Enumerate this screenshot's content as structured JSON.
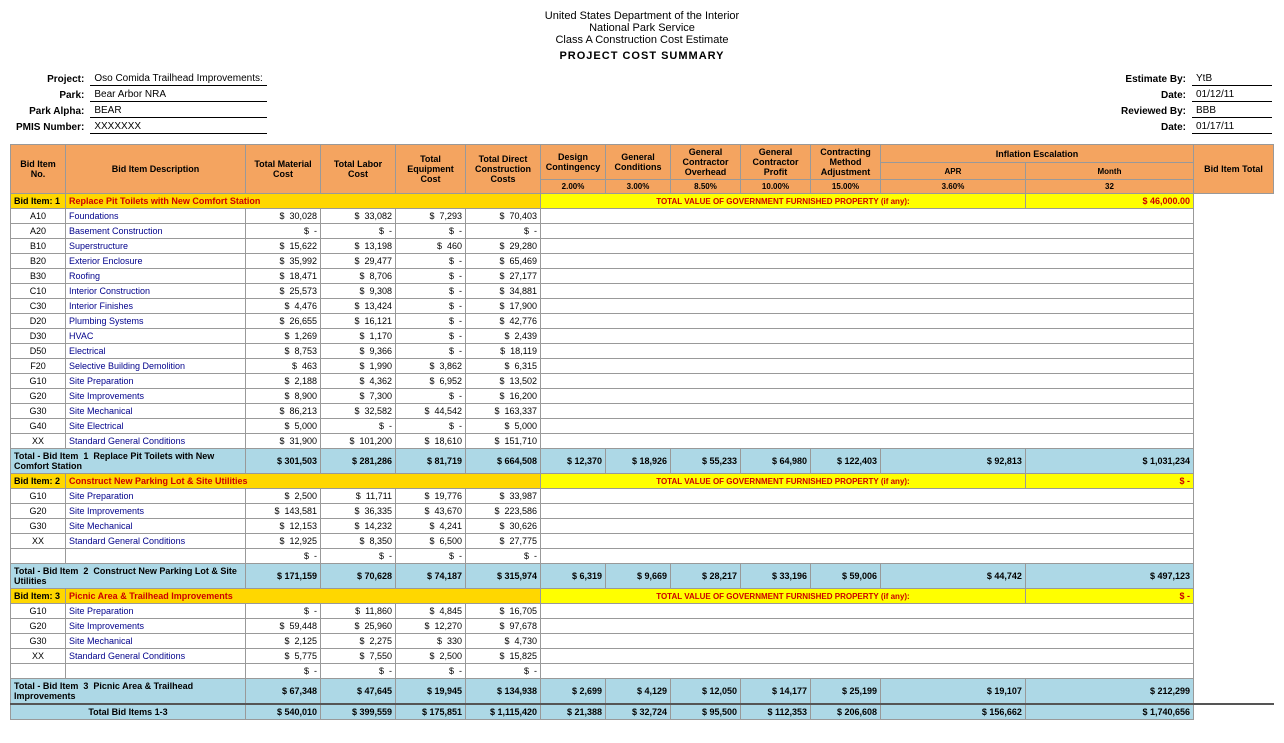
{
  "header": {
    "line1": "United States Department of the Interior",
    "line2": "National Park Service",
    "line3": "Class A Construction Cost Estimate",
    "title": "PROJECT COST SUMMARY"
  },
  "meta": {
    "project_label": "Project:",
    "project_value": "Oso Comida Trailhead Improvements:",
    "park_label": "Park:",
    "park_value": "Bear Arbor NRA",
    "alpha_label": "Park Alpha:",
    "alpha_value": "BEAR",
    "pmis_label": "PMIS Number:",
    "pmis_value": "XXXXXXX",
    "estimate_by_label": "Estimate By:",
    "estimate_by_value": "YtB",
    "date1_label": "Date:",
    "date1_value": "01/12/11",
    "reviewed_by_label": "Reviewed By:",
    "reviewed_by_value": "BBB",
    "date2_label": "Date:",
    "date2_value": "01/17/11"
  },
  "table": {
    "headers": {
      "col1": "Bid Item No.",
      "col2": "Bid Item Description",
      "col3": "Total Material Cost",
      "col4": "Total Labor Cost",
      "col5": "Total Equipment Cost",
      "col6": "Total Direct Construction Costs",
      "col7": "Design Contingency",
      "col8": "General Conditions",
      "col9": "General Contractor Overhead",
      "col10": "General Contractor Profit",
      "col11": "Contracting Method Adjustment",
      "col12_apr": "APR",
      "col12_month": "Month",
      "col12_pct": "3.60%",
      "col12_months": "32",
      "col12": "Inflation Escalation",
      "col13": "Bid Item Total",
      "pct7": "2.00%",
      "pct8": "3.00%",
      "pct9": "8.50%",
      "pct10": "10.00%",
      "pct11": "15.00%"
    },
    "bid_item_1": {
      "label": "Bid Item:",
      "number": "1",
      "desc": "Replace Pit Toilets with New Comfort Station",
      "gov_text": "TOTAL VALUE OF GOVERNMENT FURNISHED PROPERTY (if any):",
      "gov_value": "$ 46,000.00",
      "rows": [
        {
          "code": "A10",
          "desc": "Foundations",
          "mat": "$ 30,028",
          "lab": "$ 33,082",
          "eq": "$ 7,293",
          "dc": "$ 70,403"
        },
        {
          "code": "A20",
          "desc": "Basement Construction",
          "mat": "$  -",
          "lab": "$  -",
          "eq": "$  -",
          "dc": "$  -"
        },
        {
          "code": "B10",
          "desc": "Superstructure",
          "mat": "$ 15,622",
          "lab": "$ 13,198",
          "eq": "$ 460",
          "dc": "$ 29,280"
        },
        {
          "code": "B20",
          "desc": "Exterior Enclosure",
          "mat": "$ 35,992",
          "lab": "$ 29,477",
          "eq": "$  -",
          "dc": "$ 65,469"
        },
        {
          "code": "B30",
          "desc": "Roofing",
          "mat": "$ 18,471",
          "lab": "$ 8,706",
          "eq": "$  -",
          "dc": "$ 27,177"
        },
        {
          "code": "C10",
          "desc": "Interior Construction",
          "mat": "$ 25,573",
          "lab": "$ 9,308",
          "eq": "$  -",
          "dc": "$ 34,881"
        },
        {
          "code": "C30",
          "desc": "Interior Finishes",
          "mat": "$ 4,476",
          "lab": "$ 13,424",
          "eq": "$  -",
          "dc": "$ 17,900"
        },
        {
          "code": "D20",
          "desc": "Plumbing Systems",
          "mat": "$ 26,655",
          "lab": "$ 16,121",
          "eq": "$  -",
          "dc": "$ 42,776"
        },
        {
          "code": "D30",
          "desc": "HVAC",
          "mat": "$ 1,269",
          "lab": "$ 1,170",
          "eq": "$  -",
          "dc": "$ 2,439"
        },
        {
          "code": "D50",
          "desc": "Electrical",
          "mat": "$ 8,753",
          "lab": "$ 9,366",
          "eq": "$  -",
          "dc": "$ 18,119"
        },
        {
          "code": "F20",
          "desc": "Selective Building Demolition",
          "mat": "$ 463",
          "lab": "$ 1,990",
          "eq": "$ 3,862",
          "dc": "$ 6,315"
        },
        {
          "code": "G10",
          "desc": "Site Preparation",
          "mat": "$ 2,188",
          "lab": "$ 4,362",
          "eq": "$ 6,952",
          "dc": "$ 13,502"
        },
        {
          "code": "G20",
          "desc": "Site Improvements",
          "mat": "$ 8,900",
          "lab": "$ 7,300",
          "eq": "$  -",
          "dc": "$ 16,200"
        },
        {
          "code": "G30",
          "desc": "Site Mechanical",
          "mat": "$ 86,213",
          "lab": "$ 32,582",
          "eq": "$ 44,542",
          "dc": "$ 163,337"
        },
        {
          "code": "G40",
          "desc": "Site Electrical",
          "mat": "$ 5,000",
          "lab": "$  -",
          "eq": "$  -",
          "dc": "$ 5,000"
        },
        {
          "code": "XX",
          "desc": "Standard General Conditions",
          "mat": "$ 31,900",
          "lab": "$ 101,200",
          "eq": "$ 18,610",
          "dc": "$ 151,710"
        }
      ],
      "total": {
        "label": "Total - Bid Item",
        "number": "1",
        "desc": "Replace Pit Toilets with New Comfort Station",
        "mat": "$ 301,503",
        "lab": "$ 281,286",
        "eq": "$ 81,719",
        "dc": "$ 664,508",
        "des": "$ 12,370",
        "gen": "$ 18,926",
        "ovh": "$ 55,233",
        "prf": "$ 64,980",
        "cma": "$ 122,403",
        "inf": "$ 92,813",
        "tot": "$ 1,031,234"
      }
    },
    "bid_item_2": {
      "label": "Bid Item:",
      "number": "2",
      "desc": "Construct New Parking Lot & Site Utilities",
      "gov_text": "TOTAL VALUE OF GOVERNMENT FURNISHED PROPERTY (if any):",
      "gov_value": "$ -",
      "rows": [
        {
          "code": "G10",
          "desc": "Site Preparation",
          "mat": "$ 2,500",
          "lab": "$ 11,711",
          "eq": "$ 19,776",
          "dc": "$ 33,987"
        },
        {
          "code": "G20",
          "desc": "Site Improvements",
          "mat": "$ 143,581",
          "lab": "$ 36,335",
          "eq": "$ 43,670",
          "dc": "$ 223,586"
        },
        {
          "code": "G30",
          "desc": "Site Mechanical",
          "mat": "$ 12,153",
          "lab": "$ 14,232",
          "eq": "$ 4,241",
          "dc": "$ 30,626"
        },
        {
          "code": "XX",
          "desc": "Standard General Conditions",
          "mat": "$ 12,925",
          "lab": "$ 8,350",
          "eq": "$ 6,500",
          "dc": "$ 27,775"
        },
        {
          "code": "",
          "desc": "",
          "mat": "$  -",
          "lab": "$  -",
          "eq": "$  -",
          "dc": "$  -"
        }
      ],
      "total": {
        "label": "Total - Bid Item",
        "number": "2",
        "desc": "Construct New Parking Lot & Site Utilities",
        "mat": "$ 171,159",
        "lab": "$ 70,628",
        "eq": "$ 74,187",
        "dc": "$ 315,974",
        "des": "$ 6,319",
        "gen": "$ 9,669",
        "ovh": "$ 28,217",
        "prf": "$ 33,196",
        "cma": "$ 59,006",
        "inf": "$ 44,742",
        "tot": "$ 497,123"
      }
    },
    "bid_item_3": {
      "label": "Bid Item:",
      "number": "3",
      "desc": "Picnic Area & Trailhead Improvements",
      "gov_text": "TOTAL VALUE OF GOVERNMENT FURNISHED PROPERTY (if any):",
      "gov_value": "$ -",
      "rows": [
        {
          "code": "G10",
          "desc": "Site Preparation",
          "mat": "$  -",
          "lab": "$ 11,860",
          "eq": "$ 4,845",
          "dc": "$ 16,705"
        },
        {
          "code": "G20",
          "desc": "Site Improvements",
          "mat": "$ 59,448",
          "lab": "$ 25,960",
          "eq": "$ 12,270",
          "dc": "$ 97,678"
        },
        {
          "code": "G30",
          "desc": "Site Mechanical",
          "mat": "$ 2,125",
          "lab": "$ 2,275",
          "eq": "$ 330",
          "dc": "$ 4,730"
        },
        {
          "code": "XX",
          "desc": "Standard General Conditions",
          "mat": "$ 5,775",
          "lab": "$ 7,550",
          "eq": "$ 2,500",
          "dc": "$ 15,825"
        },
        {
          "code": "",
          "desc": "",
          "mat": "$  -",
          "lab": "$  -",
          "eq": "$  -",
          "dc": "$  -"
        }
      ],
      "total": {
        "label": "Total - Bid Item",
        "number": "3",
        "desc": "Picnic Area & Trailhead Improvements",
        "mat": "$ 67,348",
        "lab": "$ 47,645",
        "eq": "$ 19,945",
        "dc": "$ 134,938",
        "des": "$ 2,699",
        "gen": "$ 4,129",
        "ovh": "$ 12,050",
        "prf": "$ 14,177",
        "cma": "$ 25,199",
        "inf": "$ 19,107",
        "tot": "$ 212,299"
      }
    },
    "grand_total": {
      "label": "Total Bid Items 1-3",
      "mat": "$ 540,010",
      "lab": "$ 399,559",
      "eq": "$ 175,851",
      "dc": "$ 1,115,420",
      "des": "$ 21,388",
      "gen": "$ 32,724",
      "ovh": "$ 95,500",
      "prf": "$ 112,353",
      "cma": "$ 206,608",
      "inf": "$ 156,662",
      "tot": "$ 1,740,656"
    }
  }
}
